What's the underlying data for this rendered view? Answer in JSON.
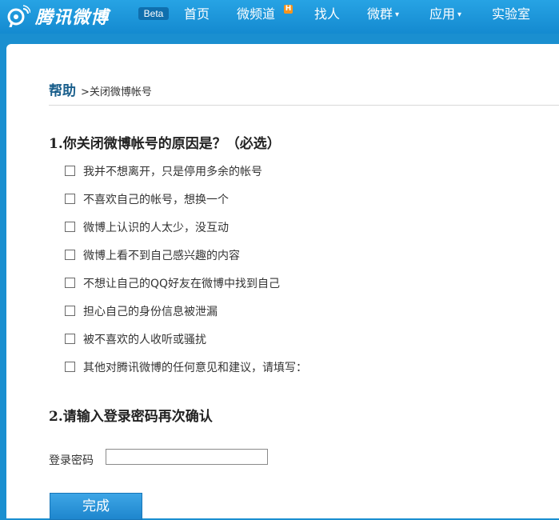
{
  "header": {
    "brand": "腾讯微博",
    "beta_label": "Beta",
    "nav": [
      {
        "label": "首页"
      },
      {
        "label": "微频道",
        "badge": "H"
      },
      {
        "label": "找人"
      },
      {
        "label": "微群",
        "dropdown": true
      },
      {
        "label": "应用",
        "dropdown": true
      },
      {
        "label": "实验室"
      }
    ],
    "caret": "▾"
  },
  "breadcrumb": {
    "help": "帮助",
    "current": ">关闭微博帐号"
  },
  "question1": {
    "title": "1.你关闭微博帐号的原因是？（必选）",
    "options": [
      "我并不想离开，只是停用多余的帐号",
      "不喜欢自己的帐号，想换一个",
      "微博上认识的人太少，没互动",
      "微博上看不到自己感兴趣的内容",
      "不想让自己的QQ好友在微博中找到自己",
      "担心自己的身份信息被泄漏",
      "被不喜欢的人收听或骚扰",
      "其他对腾讯微博的任何意见和建议，请填写："
    ]
  },
  "question2": {
    "title": "2.请输入登录密码再次确认",
    "password_label": "登录密码",
    "password_value": ""
  },
  "submit_label": "完成",
  "colors": {
    "header_blue": "#1a8fd0",
    "help_blue": "#1a5f8c",
    "button_blue": "#2a95dc",
    "hot_badge": "#f7941d"
  }
}
